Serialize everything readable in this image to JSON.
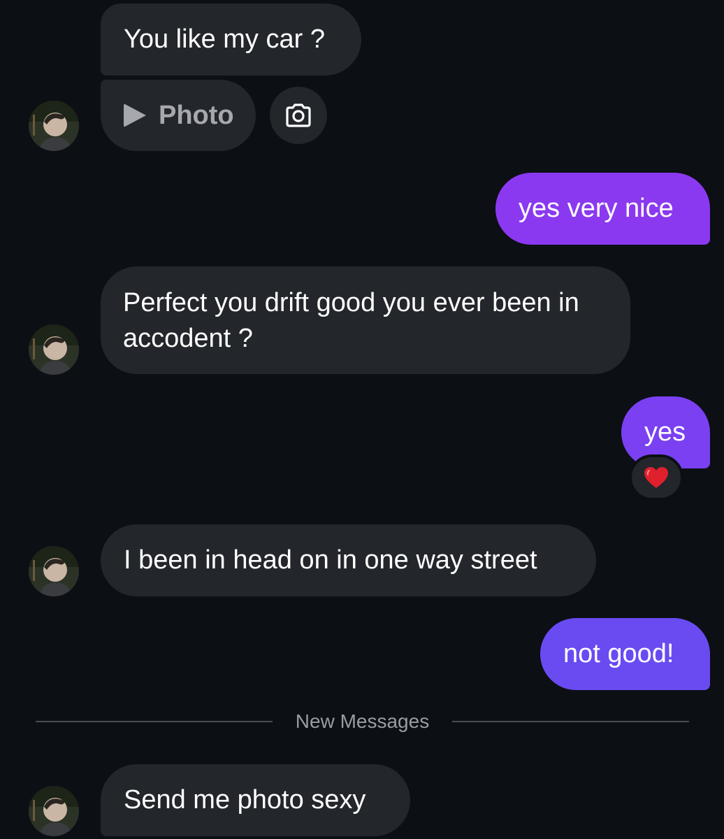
{
  "messages": {
    "m1": {
      "text": "You like my car ?"
    },
    "m2": {
      "label": "Photo",
      "play_icon": "play-icon",
      "camera_icon": "camera-icon"
    },
    "m3": {
      "text": "yes very nice"
    },
    "m4": {
      "text": "Perfect you drift good you ever been in accodent ?"
    },
    "m5": {
      "text": "yes",
      "reaction": "❤️"
    },
    "m6": {
      "text": "I been in head on in one way street"
    },
    "m7": {
      "text": "not good!"
    },
    "m8": {
      "text": "Send me photo sexy"
    }
  },
  "divider": {
    "label": "New Messages"
  },
  "colors": {
    "background": "#0c0f14",
    "incoming_bubble": "#23262b",
    "outgoing_gradient": [
      "#8b39f0",
      "#7a40f2",
      "#6a4bf2"
    ],
    "muted_text": "#9a9ca3"
  }
}
